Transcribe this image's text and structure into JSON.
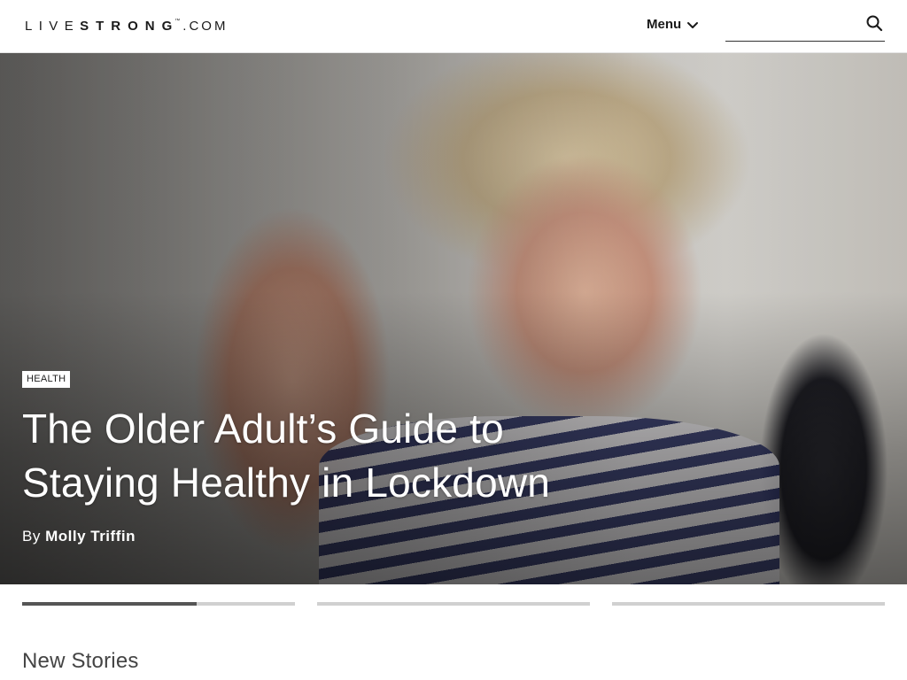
{
  "header": {
    "logo": {
      "live": "LIVE",
      "strong": "STRONG",
      "tm": "™",
      "dotcom": ".COM"
    },
    "menu_label": "Menu",
    "search": {
      "value": "",
      "placeholder": ""
    },
    "icons": {
      "menu_chevron": "chevron-down-icon",
      "search": "search-icon"
    }
  },
  "hero": {
    "tag": "HEALTH",
    "title": "The Older Adult’s Guide to Staying Healthy in Lockdown",
    "byline_prefix": "By",
    "author": "Molly Triffin"
  },
  "carousel": {
    "slides": 3,
    "active_index": 0,
    "active_progress_percent": 64
  },
  "sections": {
    "new_stories_title": "New Stories"
  },
  "colors": {
    "progress_track": "#d0d0d0",
    "progress_fill": "#555555",
    "tag_bg": "#ffffff"
  }
}
